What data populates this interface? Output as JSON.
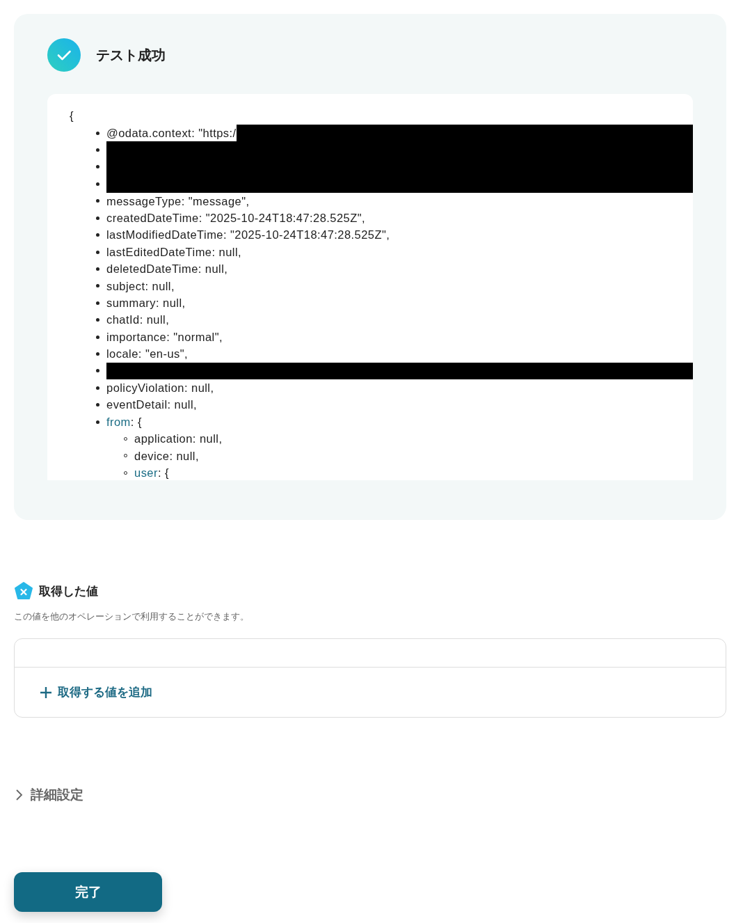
{
  "result": {
    "title": "テスト成功",
    "success": true,
    "lines": [
      {
        "kind": "partial",
        "key": "@odata.context",
        "text": ": \"https:/"
      },
      {
        "kind": "redacted"
      },
      {
        "kind": "redacted"
      },
      {
        "kind": "redacted"
      },
      {
        "kind": "field",
        "key": "messageType",
        "text": ": \"message\","
      },
      {
        "kind": "field",
        "key": "createdDateTime",
        "text": ": \"2025-10-24T18:47:28.525Z\","
      },
      {
        "kind": "field",
        "key": "lastModifiedDateTime",
        "text": ": \"2025-10-24T18:47:28.525Z\","
      },
      {
        "kind": "field",
        "key": "lastEditedDateTime",
        "text": ": null,"
      },
      {
        "kind": "field",
        "key": "deletedDateTime",
        "text": ": null,"
      },
      {
        "kind": "field",
        "key": "subject",
        "text": ": null,"
      },
      {
        "kind": "field",
        "key": "summary",
        "text": ": null,"
      },
      {
        "kind": "field",
        "key": "chatId",
        "text": ": null,"
      },
      {
        "kind": "field",
        "key": "importance",
        "text": ": \"normal\","
      },
      {
        "kind": "field",
        "key": "locale",
        "text": ": \"en-us\","
      },
      {
        "kind": "redacted"
      },
      {
        "kind": "field",
        "key": "policyViolation",
        "text": ": null,"
      },
      {
        "kind": "field",
        "key": "eventDetail",
        "text": ": null,"
      },
      {
        "kind": "object",
        "key": "from",
        "text": ": {",
        "children": [
          {
            "kind": "field",
            "key": "application",
            "text": ": null,"
          },
          {
            "kind": "field",
            "key": "device",
            "text": ": null,"
          },
          {
            "kind": "object",
            "key": "user",
            "text": ": {"
          }
        ]
      }
    ],
    "open_brace": "{"
  },
  "values": {
    "title": "取得した値",
    "description": "この値を他のオペレーションで利用することができます。",
    "add_label": "取得する値を追加"
  },
  "advanced": {
    "label": "詳細設定",
    "expanded": false
  },
  "done_button": "完了"
}
